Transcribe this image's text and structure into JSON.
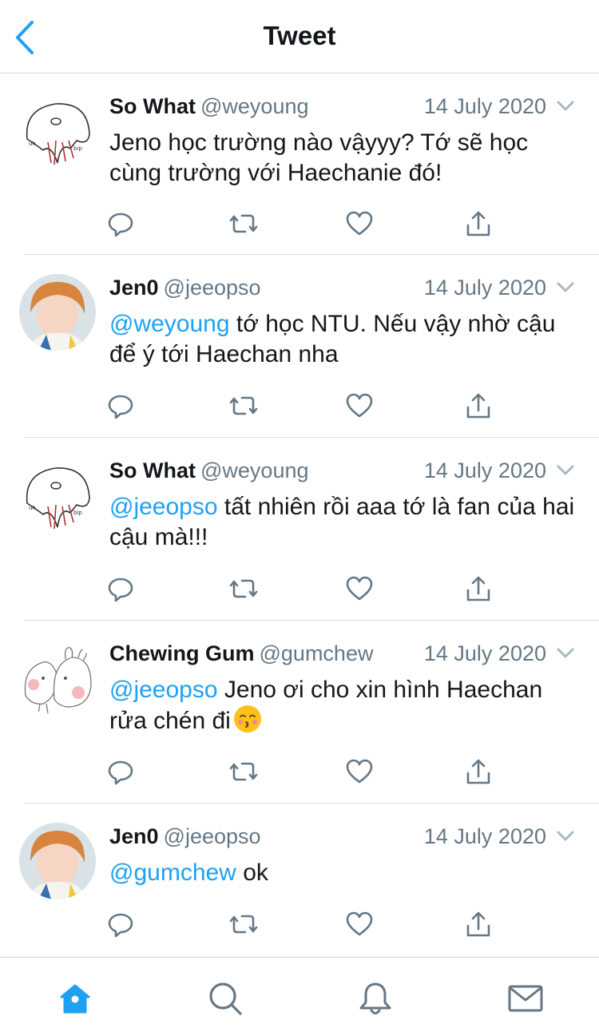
{
  "header": {
    "title": "Tweet"
  },
  "tweets": [
    {
      "name": "So What",
      "handle": "@weyoung",
      "date": "14 July 2020",
      "mention": "",
      "text": "Jeno học trường nào vậyyy? Tớ sẽ học cùng trường với Haechanie đó!",
      "avatar": "cartoon-avatar-icon"
    },
    {
      "name": "Jen0",
      "handle": "@jeeopso",
      "date": "14 July 2020",
      "mention": "@weyoung",
      "text": " tớ học NTU. Nếu vậy nhờ cậu để ý tới Haechan nha",
      "avatar": "photo-avatar"
    },
    {
      "name": "So What",
      "handle": "@weyoung",
      "date": "14 July 2020",
      "mention": "@jeeopso",
      "text": " tất nhiên rồi aaa tớ là fan của hai cậu mà!!!",
      "avatar": "cartoon-avatar-icon"
    },
    {
      "name": "Chewing Gum",
      "handle": "@gumchew",
      "date": "14 July 2020",
      "mention": "@jeeopso",
      "text": " Jeno ơi cho xin hình Haechan rửa chén đi",
      "avatar": "bunny-avatar-icon",
      "emoji": "kissing-face-icon"
    },
    {
      "name": "Jen0",
      "handle": "@jeeopso",
      "date": "14 July 2020",
      "mention": "@gumchew",
      "text": " ok",
      "avatar": "photo-avatar"
    }
  ],
  "actions": [
    "reply-icon",
    "retweet-icon",
    "like-icon",
    "share-icon"
  ],
  "tabbar": [
    "home-icon",
    "search-icon",
    "notifications-icon",
    "messages-icon"
  ],
  "colors": {
    "accent": "#1da1f2",
    "icon": "#657786",
    "text": "#14171a",
    "divider": "#d9dde0"
  }
}
